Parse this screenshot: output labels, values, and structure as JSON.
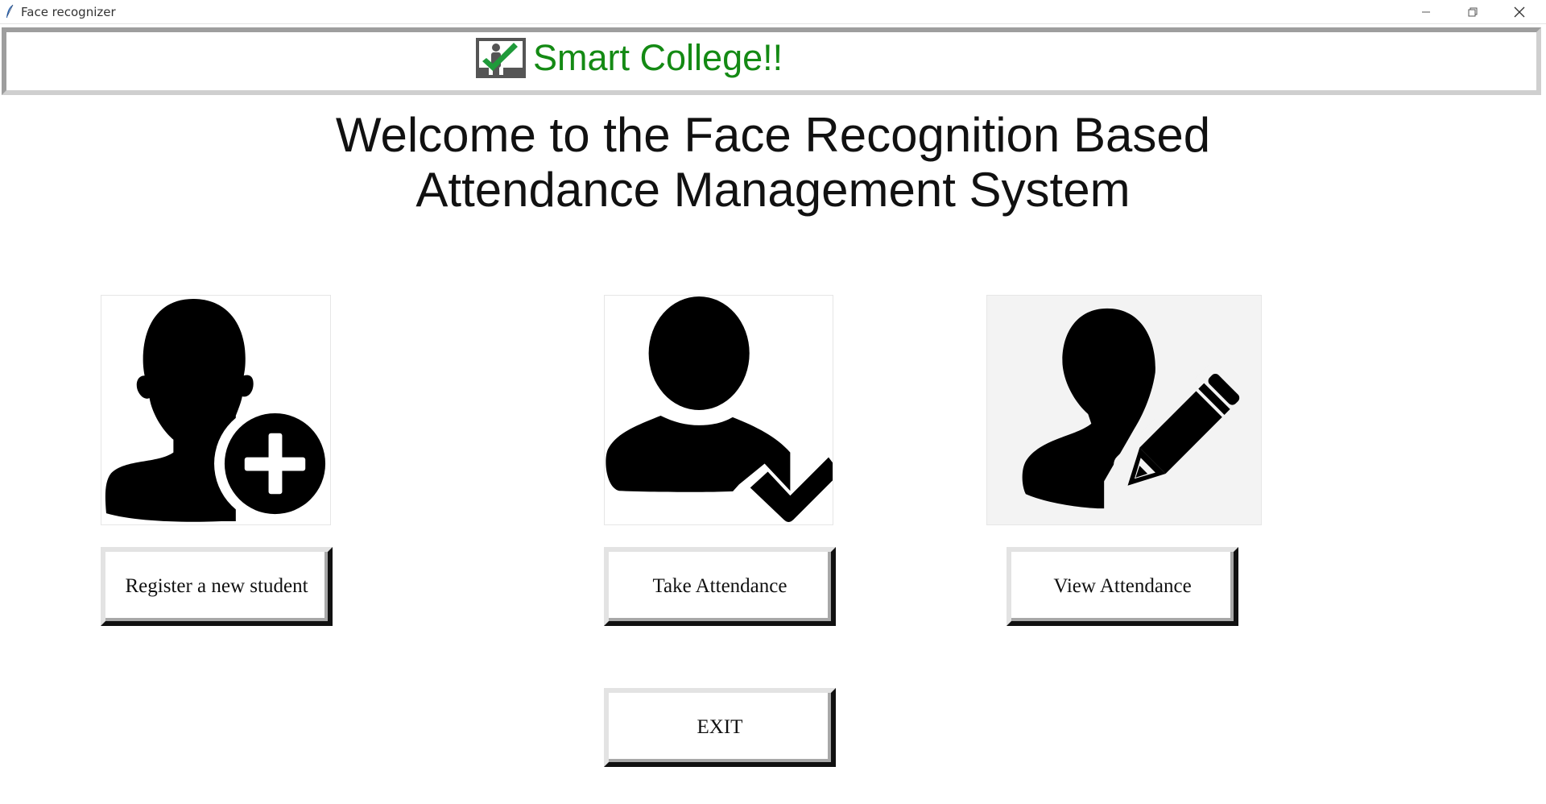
{
  "window": {
    "title": "Face recognizer",
    "controls": [
      "minimize-icon",
      "restore-icon",
      "close-icon"
    ]
  },
  "banner": {
    "logo_icon": "attendance-board-check-icon",
    "text": "Smart College!!",
    "text_color": "#148a14"
  },
  "headline": {
    "line1": "Welcome to the Face Recognition Based",
    "line2": "Attendance Management System"
  },
  "actions": {
    "register": {
      "icon": "user-add-icon",
      "label": "Register a new student"
    },
    "take": {
      "icon": "user-check-icon",
      "label": "Take Attendance"
    },
    "view": {
      "icon": "user-edit-icon",
      "label": "View Attendance"
    },
    "exit": {
      "label": "EXIT"
    }
  }
}
